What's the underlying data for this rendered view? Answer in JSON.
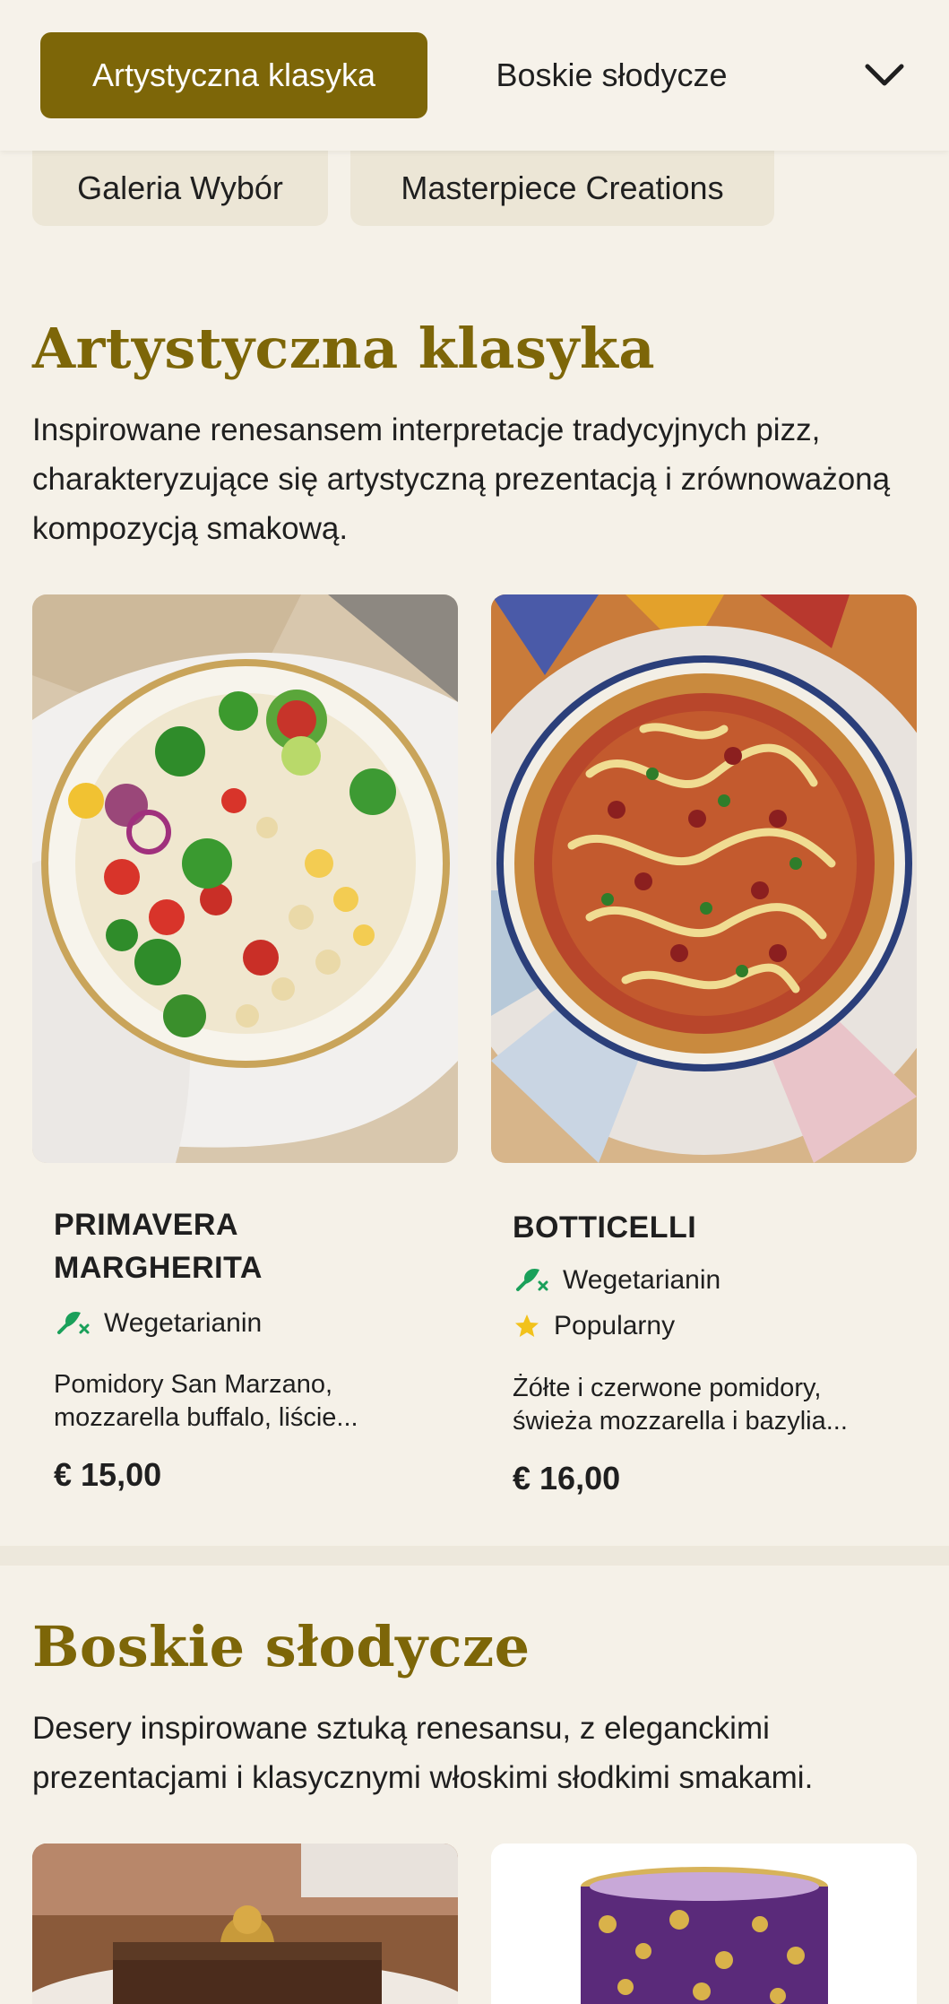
{
  "nav": {
    "tabs": [
      {
        "label": "Artystyczna klasyka"
      },
      {
        "label": "Boskie słodycze"
      }
    ],
    "subtabs": [
      {
        "label": "Galeria Wybór"
      },
      {
        "label": "Masterpiece Creations"
      }
    ],
    "expand_icon": "chevron-down-icon"
  },
  "sections": [
    {
      "title": "Artystyczna klasyka",
      "description": "Inspirowane renesansem interpretacje tradycyjnych pizz, charakteryzujące się artystyczną prezentacją i zrównoważoną kompozycją smakową.",
      "items": [
        {
          "name": "Primavera Margherita",
          "tags": [
            {
              "icon": "vegetarian-icon",
              "label": "Wegetarianin"
            }
          ],
          "description": "Pomidory San Marzano, mozzarella buffalo, liście...",
          "price": "€ 15,00"
        },
        {
          "name": "Botticelli",
          "tags": [
            {
              "icon": "vegetarian-icon",
              "label": "Wegetarianin"
            },
            {
              "icon": "star-icon",
              "label": "Popularny"
            }
          ],
          "description": "Żółte i czerwone pomidory, świeża mozzarella i bazylia...",
          "price": "€ 16,00"
        }
      ]
    },
    {
      "title": "Boskie słodycze",
      "description": "Desery inspirowane sztuką renesansu, z eleganckimi prezentacjami i klasycznymi włoskimi słodkimi smakami."
    }
  ],
  "colors": {
    "accent": "#7d6608",
    "background": "#f5f1e8",
    "vegetarian": "#1aa05a",
    "popular": "#f2c21b"
  }
}
